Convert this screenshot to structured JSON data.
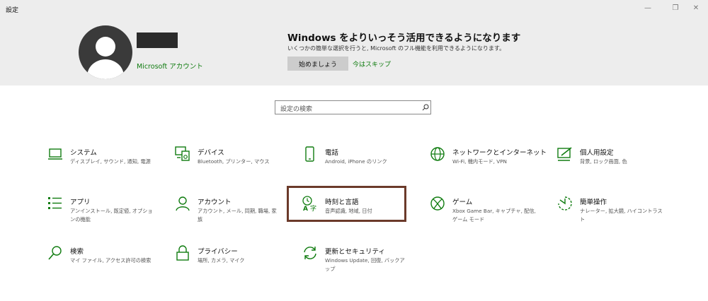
{
  "window": {
    "title": "設定",
    "minimize_glyph": "—",
    "maximize_glyph": "❐",
    "close_glyph": "✕"
  },
  "account": {
    "link_label": "Microsoft アカウント"
  },
  "promo": {
    "title": "Windows をよりいっそう活用できるようになります",
    "description": "いくつかの簡単な選択を行うと, Microsoft のフル機能を利用できるようになります。",
    "start_button": "始めましょう",
    "skip_link": "今はスキップ"
  },
  "search": {
    "placeholder": "設定の検索"
  },
  "accent_color": "#107c10",
  "highlight_color": "#6b3a2a",
  "tiles": [
    {
      "title": "システム",
      "desc": "ディスプレイ, サウンド, 通知, 電源",
      "icon": "laptop-icon"
    },
    {
      "title": "デバイス",
      "desc": "Bluetooth, プリンター, マウス",
      "icon": "devices-icon"
    },
    {
      "title": "電話",
      "desc": "Android, iPhone のリンク",
      "icon": "phone-icon"
    },
    {
      "title": "ネットワークとインターネット",
      "desc": "Wi-Fi, 機内モード, VPN",
      "icon": "globe-icon"
    },
    {
      "title": "個人用設定",
      "desc": "背景, ロック画面, 色",
      "icon": "personalization-icon"
    },
    {
      "title": "アプリ",
      "desc": "アンインストール, 既定値, オプションの機能",
      "icon": "apps-list-icon"
    },
    {
      "title": "アカウント",
      "desc": "アカウント, メール, 同期, 職場, 家族",
      "icon": "person-icon"
    },
    {
      "title": "時刻と言語",
      "desc": "音声認識, 地域, 日付",
      "icon": "time-language-icon"
    },
    {
      "title": "ゲーム",
      "desc": "Xbox Game Bar, キャプチャ, 配信, ゲーム モード",
      "icon": "xbox-icon"
    },
    {
      "title": "簡単操作",
      "desc": "ナレーター, 拡大鏡, ハイコントラスト",
      "icon": "ease-of-access-icon"
    },
    {
      "title": "検索",
      "desc": "マイ ファイル, アクセス許可の検索",
      "icon": "search-icon"
    },
    {
      "title": "プライバシー",
      "desc": "場所, カメラ, マイク",
      "icon": "lock-icon"
    },
    {
      "title": "更新とセキュリティ",
      "desc": "Windows Update, 回復, バックアップ",
      "icon": "update-icon"
    }
  ]
}
